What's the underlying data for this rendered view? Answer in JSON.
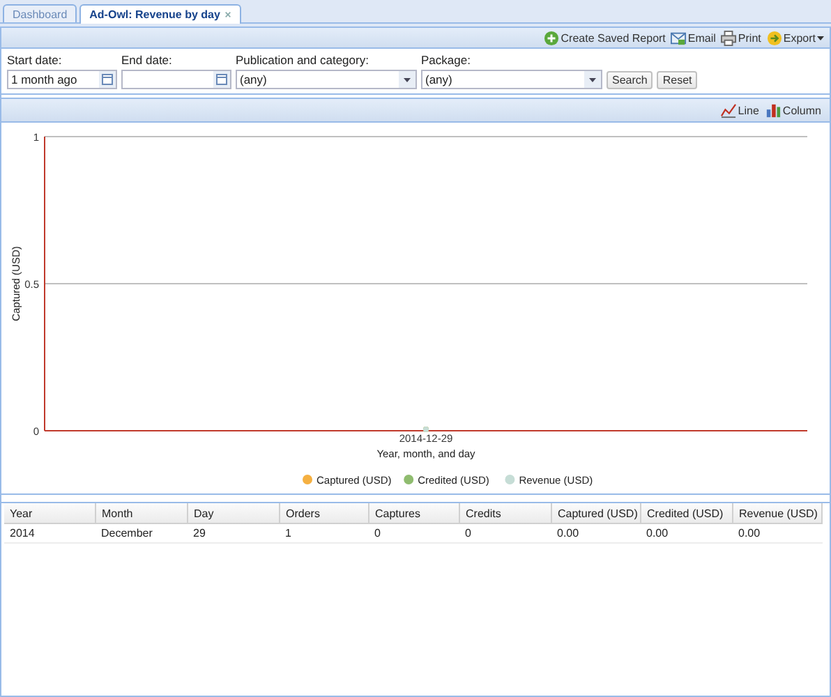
{
  "tabs": [
    {
      "label": "Dashboard",
      "selected": false,
      "closable": false
    },
    {
      "label": "Ad-Owl: Revenue by day",
      "selected": true,
      "closable": true
    }
  ],
  "toolbar": {
    "actions": [
      {
        "label": "Create Saved Report",
        "kind": "add",
        "menu": false
      },
      {
        "label": "Email",
        "kind": "email",
        "menu": false
      },
      {
        "label": "Print",
        "kind": "print",
        "menu": false
      },
      {
        "label": "Export",
        "kind": "export",
        "menu": true
      }
    ]
  },
  "filters": [
    {
      "label": "Start date:",
      "kind": "date",
      "value": "1 month ago"
    },
    {
      "label": "End date:",
      "kind": "date"
    },
    {
      "label": "Publication and category:",
      "kind": "select",
      "value": "(any)"
    },
    {
      "label": "Package:",
      "kind": "select",
      "value": "(any)"
    }
  ],
  "filter_buttons": [
    "Search",
    "Reset"
  ],
  "chart_toolbar": [
    {
      "label": "Line",
      "kind": "line"
    },
    {
      "label": "Column",
      "kind": "column"
    }
  ],
  "chart": {
    "chart_data": {
      "type": "line",
      "xlabel": "Year, month, and day",
      "ylabel": "Captured (USD)",
      "categories": [
        "2014-12-29"
      ],
      "legend": "bottom",
      "series": [
        {
          "name": "Captured (USD)",
          "color": "#f5b041",
          "marker": "circle",
          "values": [
            0
          ]
        },
        {
          "name": "Credited (USD)",
          "color": "#8fbc6f",
          "marker": "circle",
          "values": [
            0
          ]
        },
        {
          "name": "Revenue (USD)",
          "color": "#c6ddd6",
          "marker": "circle",
          "values": [
            0
          ]
        }
      ],
      "ylim": [
        0,
        1
      ],
      "yticks": [
        0,
        0.5,
        1
      ]
    }
  },
  "grid": {
    "columns": [
      "Year",
      "Month",
      "Day",
      "Orders",
      "Captures",
      "Credits",
      "Captured (USD)",
      "Credited (USD)",
      "Revenue (USD)"
    ],
    "rows": [
      [
        "2014",
        "December",
        "29",
        "1",
        "0",
        "0",
        "0.00",
        "0.00",
        "0.00"
      ]
    ]
  }
}
